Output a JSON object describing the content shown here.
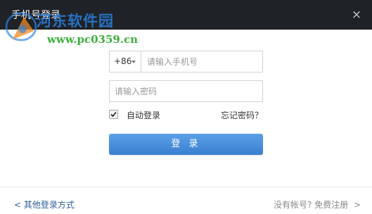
{
  "window": {
    "title": "手机号登录",
    "close_label": "×"
  },
  "watermark": {
    "site_name": "河东软件园",
    "url": "www.pc0359.cn"
  },
  "form": {
    "country_code": "+86",
    "phone_placeholder": "请输入手机号",
    "password_placeholder": "请输入密码",
    "auto_login_label": "自动登录",
    "auto_login_checked": true,
    "forgot_password": "忘记密码？",
    "login_button": "登 录"
  },
  "footer": {
    "other_login": "其他登录方式",
    "no_account": "没有帐号?",
    "register": "免费注册"
  },
  "colors": {
    "titlebar": "#1f2226",
    "button_blue": "#3a7fcf",
    "link_blue": "#2f5f99"
  }
}
